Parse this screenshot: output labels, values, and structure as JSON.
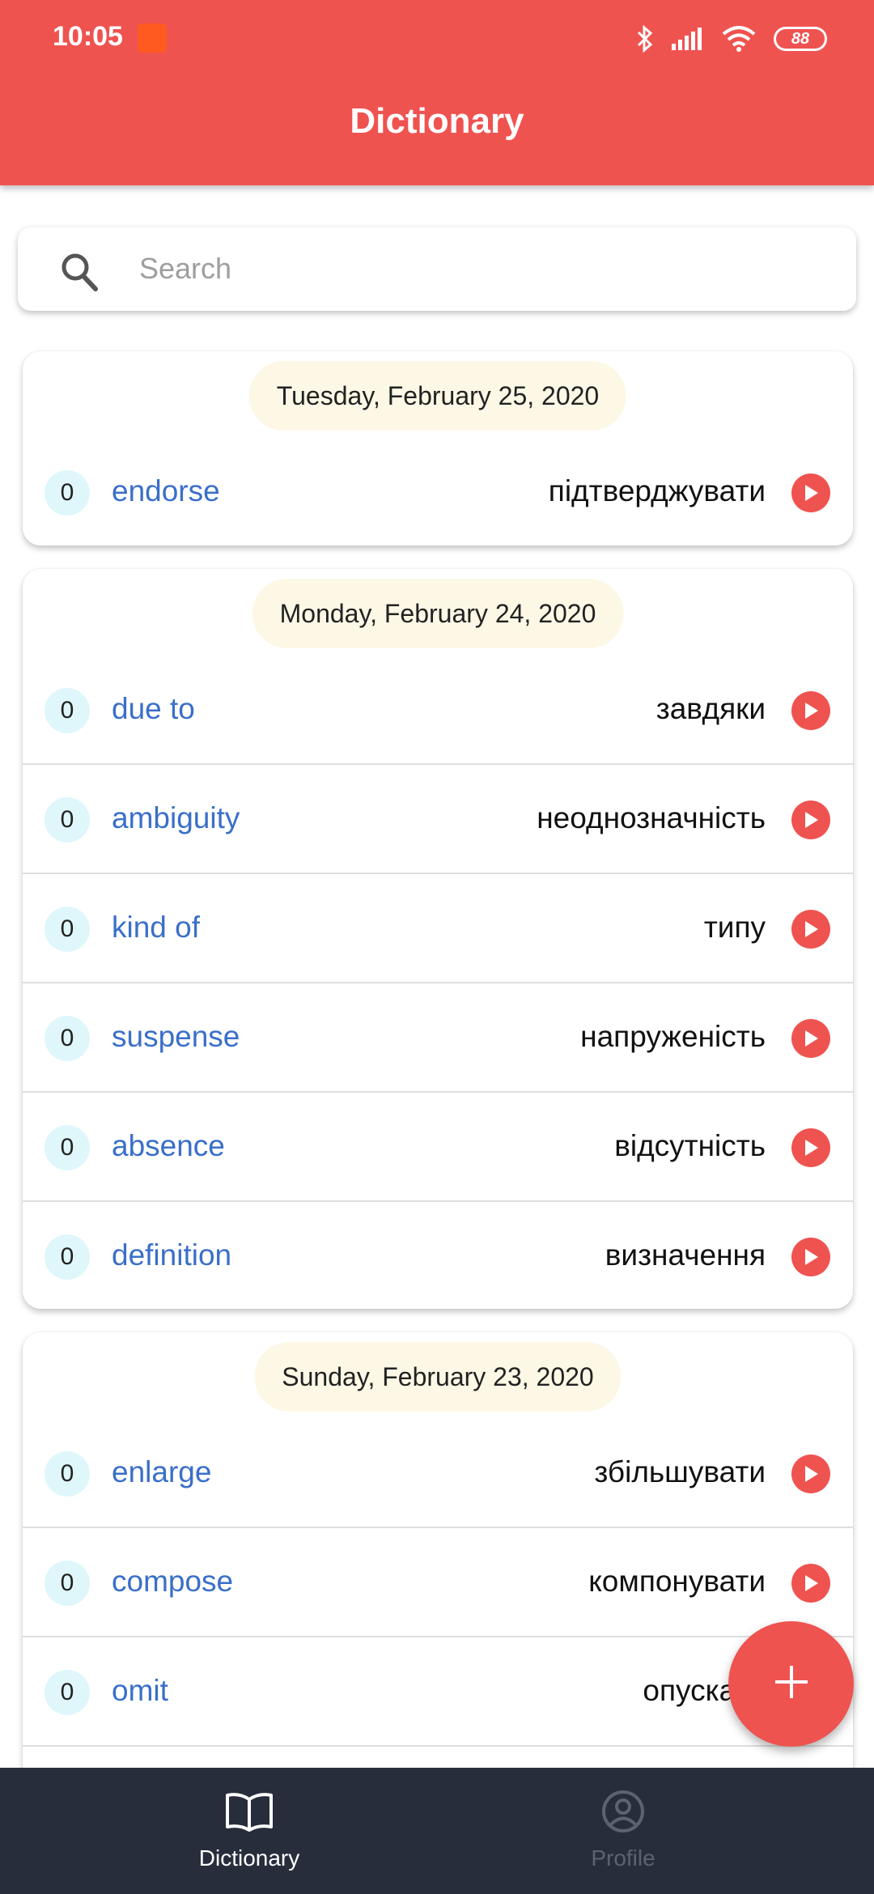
{
  "status_bar": {
    "time": "10:05",
    "battery": "88",
    "icons": [
      "notification-app-icon",
      "bluetooth-icon",
      "signal-icon",
      "wifi-icon",
      "battery-icon"
    ]
  },
  "header": {
    "title": "Dictionary"
  },
  "search": {
    "placeholder": "Search",
    "value": ""
  },
  "groups": [
    {
      "date": "Tuesday, February 25, 2020",
      "entries": [
        {
          "count": "0",
          "word": "endorse",
          "translation": "підтверджувати"
        }
      ]
    },
    {
      "date": "Monday, February 24, 2020",
      "entries": [
        {
          "count": "0",
          "word": "due to",
          "translation": "завдяки"
        },
        {
          "count": "0",
          "word": "ambiguity",
          "translation": "неоднозначність"
        },
        {
          "count": "0",
          "word": "kind of",
          "translation": "типу"
        },
        {
          "count": "0",
          "word": "suspense",
          "translation": "напруженість"
        },
        {
          "count": "0",
          "word": "absence",
          "translation": "відсутність"
        },
        {
          "count": "0",
          "word": "definition",
          "translation": "визначення"
        }
      ]
    },
    {
      "date": "Sunday, February 23, 2020",
      "entries": [
        {
          "count": "0",
          "word": "enlarge",
          "translation": "збільшувати"
        },
        {
          "count": "0",
          "word": "compose",
          "translation": "компонувати"
        },
        {
          "count": "0",
          "word": "omit",
          "translation": "опускати"
        }
      ]
    }
  ],
  "bottom_nav": {
    "items": [
      {
        "label": "Dictionary",
        "icon": "book-icon",
        "active": true
      },
      {
        "label": "Profile",
        "icon": "profile-icon",
        "active": false
      }
    ]
  },
  "colors": {
    "accent": "#ef5350",
    "word": "#3a6fc9",
    "date_chip": "#fdf8e6",
    "count_badge": "#dff7fb",
    "nav_background": "#272d3b"
  }
}
